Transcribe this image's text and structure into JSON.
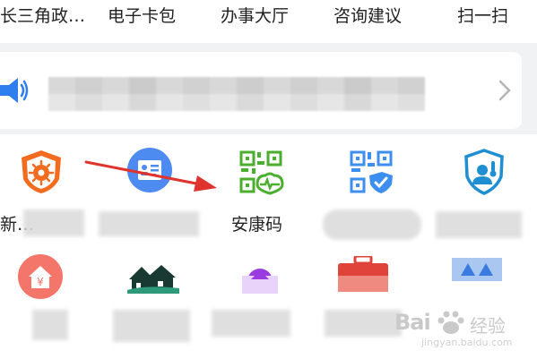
{
  "top_tabs": [
    {
      "label": "长三角政…"
    },
    {
      "label": "电子卡包"
    },
    {
      "label": "办事大厅"
    },
    {
      "label": "咨询建议"
    },
    {
      "label": "扫一扫"
    }
  ],
  "notice": {
    "icon": "speaker-icon",
    "chevron": "chevron-right-icon"
  },
  "services_row1": [
    {
      "label": "新…",
      "icon": "virus-shield-icon",
      "color": "#f26b1f"
    },
    {
      "label": "",
      "icon": "id-card-icon",
      "color": "#4d8bf0"
    },
    {
      "label": "安康码",
      "icon": "health-qr-icon",
      "color": "#4cae2e"
    },
    {
      "label": "",
      "icon": "qr-heart-shield-icon",
      "color": "#3c8ff0"
    },
    {
      "label": "",
      "icon": "temperature-shield-icon",
      "color": "#1f8fd1"
    }
  ],
  "services_row2": [
    {
      "icon": "house-yuan-icon",
      "color": "#f26b5b"
    },
    {
      "icon": "houses-icon",
      "color": "#1f6a5a"
    },
    {
      "icon": "purple-badge-icon",
      "color": "#9b3ce0"
    },
    {
      "icon": "briefcase-icon",
      "color": "#e0433a"
    },
    {
      "icon": "banner-icon",
      "color": "#3b7be0"
    }
  ],
  "watermark": {
    "brand": "Bai",
    "brand_cn": "经验",
    "url": "jingyan.baidu.com"
  },
  "annotation": {
    "arrow_color": "#e0332d"
  }
}
